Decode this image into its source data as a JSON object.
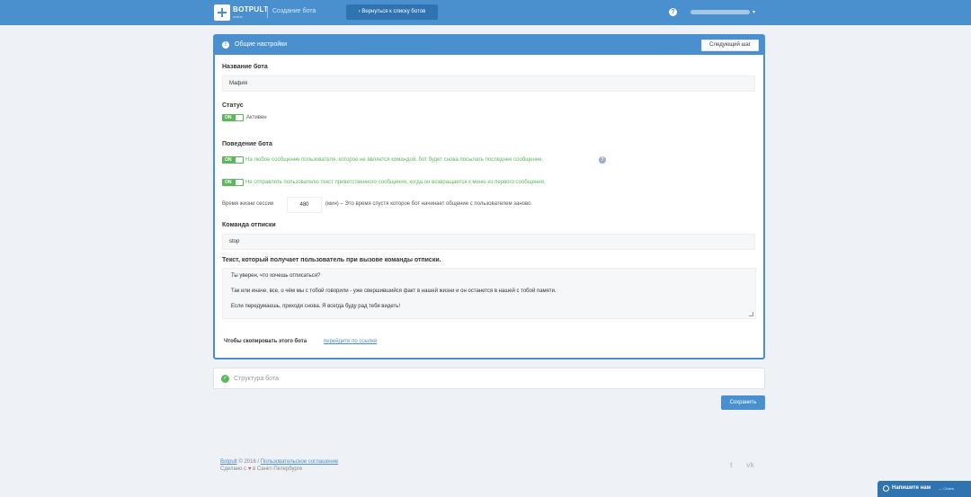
{
  "header": {
    "logo_name": "BOTPULT",
    "logo_sub": "online",
    "page_crumb": "Создание бота",
    "back_button": "‹ Вернуться к списку ботов",
    "help_icon": "?",
    "user_caret": "▾"
  },
  "general_panel": {
    "title": "Общие настройки",
    "next_button": "Следующий шаг",
    "bot_name_label": "Название бота",
    "bot_name_value": "Мафия",
    "status_label": "Статус",
    "status_toggle": "ON",
    "status_text": "Активен",
    "behavior_label": "Поведение бота",
    "behavior_option1": "На любое сообщение пользователя, которое не является командой, бот будет снова посылать последнее сообщение.",
    "behavior_option2": "Не отправлять пользователю текст приветственного сообщения, когда он возвращается к меню из первого сообщения.",
    "toggle_on": "ON",
    "session_label": "Время жизни сессии",
    "session_value": "480",
    "session_hint": "(мин) – Это время спустя которое бот начинает общение с пользователем заново.",
    "unsubscribe_label": "Команда отписки",
    "unsubscribe_value": "stop",
    "unsubscribe_text_label": "Текст, который получает пользователь при вызове команды отписки.",
    "unsubscribe_lines": [
      "Ты уверен, что хочешь отписаться?",
      "Так или иначе, все, о чём мы с тобой говорили - уже свершившийся факт в нашей жизни и он останется в нашей с тобой памяти.",
      "Если передумаешь, приходи снова. Я всегда буду рад тебя видеть!"
    ],
    "copy_label": "Чтобы скопировать этого бота",
    "copy_link": "перейдите по ссылке"
  },
  "structure_panel": {
    "title": "Структура бота"
  },
  "save_button": "Сохранить",
  "footer": {
    "brand": "Botpult",
    "year": "© 2016 /",
    "agreement": "Пользовательское соглашение",
    "made_prefix": "Сделано с",
    "made_suffix": "в Санкт-Петербурге",
    "twitter": "t",
    "vk": "vk"
  },
  "chat": {
    "label": "Напишите нам",
    "sub": "— Chatra"
  },
  "colors": {
    "primary": "#4a90cf",
    "toggle_on": "#5cb85c",
    "background": "#eef1f5"
  },
  "icons": [
    "logo-icon",
    "help-icon",
    "info-icon",
    "check-icon",
    "heart-icon",
    "twitter-icon",
    "vk-icon",
    "chat-icon"
  ]
}
